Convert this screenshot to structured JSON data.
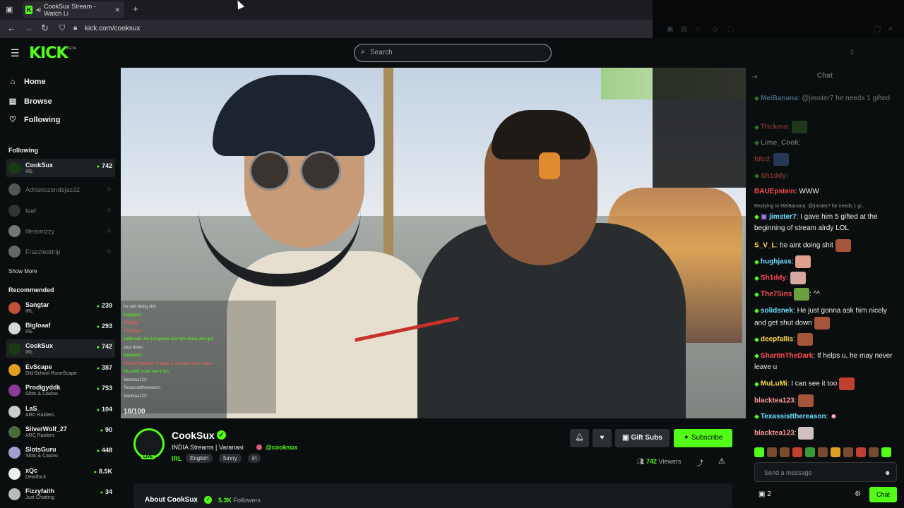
{
  "browser": {
    "tab_title": "CookSux Stream - Watch Li",
    "url": "kick.com/cooksux"
  },
  "header": {
    "logo": "KICK",
    "beta": "BETA",
    "search_placeholder": "Search"
  },
  "sidebar": {
    "nav": [
      {
        "label": "Home",
        "icon": "home-icon"
      },
      {
        "label": "Browse",
        "icon": "browse-icon"
      },
      {
        "label": "Following",
        "icon": "heart-icon"
      }
    ],
    "following_title": "Following",
    "following": [
      {
        "name": "CookSux",
        "category": "IRL",
        "viewers": "742",
        "live": true
      },
      {
        "name": "Adrianozendejas32",
        "live": false
      },
      {
        "name": "feef",
        "live": false
      },
      {
        "name": "lifeismizzy",
        "live": false
      },
      {
        "name": "Frazzleddrip",
        "live": false
      }
    ],
    "show_more": "Show More",
    "recommended_title": "Recommended",
    "recommended": [
      {
        "name": "Sangtar",
        "category": "IRL",
        "viewers": "239"
      },
      {
        "name": "Bigloaaf",
        "category": "IRL",
        "viewers": "293"
      },
      {
        "name": "CookSux",
        "category": "IRL",
        "viewers": "742"
      },
      {
        "name": "EvScape",
        "category": "Old School RuneScape",
        "viewers": "387"
      },
      {
        "name": "Prodigyddk",
        "category": "Slots & Casino",
        "viewers": "753"
      },
      {
        "name": "LaS_",
        "category": "ARC Raiders",
        "viewers": "104"
      },
      {
        "name": "SilverWolf_27",
        "category": "ARC Raiders",
        "viewers": "90"
      },
      {
        "name": "SlotsGuru",
        "category": "Slots & Casino",
        "viewers": "448"
      },
      {
        "name": "xQc",
        "category": "Deadlock",
        "viewers": "8.5K"
      },
      {
        "name": "Fizzyfaith",
        "category": "Just Chatting",
        "viewers": "34"
      }
    ]
  },
  "video": {
    "counter": "18/100",
    "overlay_lines": [
      "he aint doing shit",
      "hughjass:",
      "Sh1ddy:",
      "The7Sins:",
      "solidsnek: He just gonna ask him nicely and get",
      "shut down",
      "deepfallis:",
      "ShartInTheDark: If helps u, he may never leave",
      "MuLuMi: I can see it too",
      "blacktea123:",
      "Texassistthereason:",
      "blacktea123:"
    ]
  },
  "stream": {
    "channel_name": "CookSux",
    "live_badge": "LIVE",
    "title": "INDIA Streams | Varanasi",
    "handle": "@cooksux",
    "category": "IRL",
    "tags": [
      "English",
      "funny",
      "irl"
    ],
    "gift_subs_label": "Gift Subs",
    "subscribe_label": "Subscribe",
    "viewers_count": "742",
    "viewers_label": "Viewers",
    "about_title": "About CookSux",
    "followers_count": "5.3K",
    "followers_label": "Followers"
  },
  "chat": {
    "title": "Chat",
    "ghost_count": "2",
    "messages_dim": [
      {
        "user": "MeiBanana",
        "text": ": @jimster7 he needs 1 gifted",
        "color": "#7ec8ff"
      },
      {
        "user": "Trickmo",
        "text": ":",
        "color": "#ff5a5a"
      },
      {
        "user": "Lime_Cook",
        "text": ":",
        "color": "#cccccc"
      },
      {
        "user": "hfcd",
        "text": ":",
        "color": "#ff5a5a"
      },
      {
        "user": "Sh1ddy",
        "text": ":",
        "color": "#ff5a5a"
      }
    ],
    "messages": [
      {
        "user": "BAUEpstein",
        "text": ": WWW",
        "color": "#ff4d4d"
      },
      {
        "user": "jimster7",
        "text": ": I gave him 5 gifted at the beginning of stream alrdy LOL",
        "color": "#6fe0ff"
      },
      {
        "user": "S_V_L",
        "text": ": he aint doing shit",
        "color": "#ffd84d"
      },
      {
        "user": "hughjass",
        "text": ":",
        "color": "#6fe0ff"
      },
      {
        "user": "Sh1ddy",
        "text": ":",
        "color": "#ff4d4d"
      },
      {
        "user": "The7Sins",
        "text": ": ^^",
        "color": "#ff4d4d"
      },
      {
        "user": "solidsnek",
        "text": ": He just gonna ask him nicely and get shut down",
        "color": "#6fe0ff"
      },
      {
        "user": "deepfallis",
        "text": ":",
        "color": "#ffd84d"
      },
      {
        "user": "ShartInTheDark",
        "text": ": If helps u, he may never leave u",
        "color": "#ff4d4d"
      },
      {
        "user": "MuLuMi",
        "text": ": I can see it too",
        "color": "#ffd84d"
      },
      {
        "user": "blacktea123",
        "text": ":",
        "color": "#ff9b9b"
      },
      {
        "user": "Texassistthereason",
        "text": ":",
        "color": "#6fe0ff"
      },
      {
        "user": "blacktea123",
        "text": ":",
        "color": "#ff9b9b"
      }
    ],
    "reply_text": "Replying to MeiBanana: @jimster7 he needs 1 gi...",
    "input_placeholder": "Send a message",
    "gift_count": "2",
    "chat_button": "Chat"
  },
  "colors": {
    "accent": "#53fc18",
    "background": "#0b0e0f"
  }
}
